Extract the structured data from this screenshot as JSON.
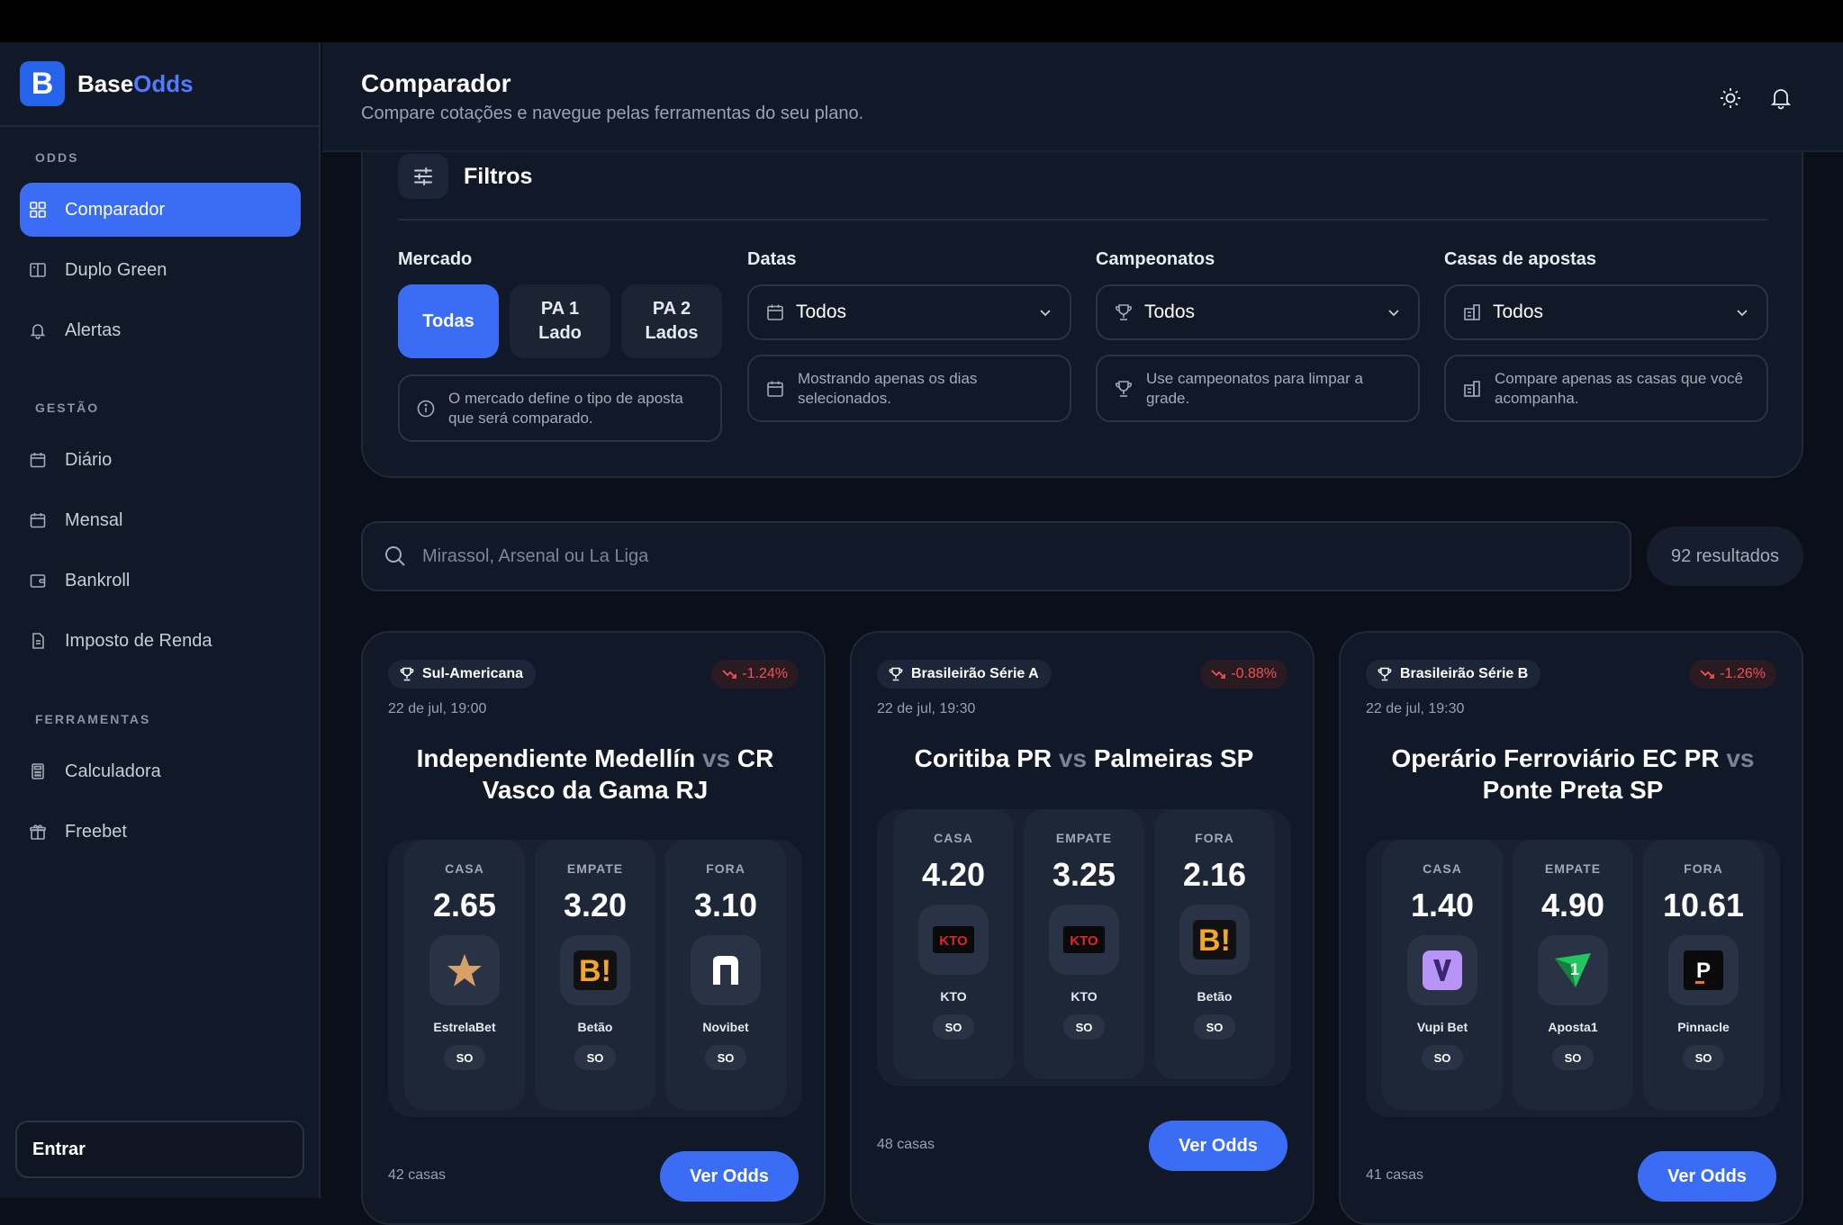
{
  "brand": {
    "name_base": "Base",
    "name_accent": "Odds",
    "logo_letter": "B"
  },
  "sidebar": {
    "sections": [
      {
        "label": "ODDS",
        "items": [
          {
            "label": "Comparador",
            "icon": "grid-icon",
            "active": true
          },
          {
            "label": "Duplo Green",
            "icon": "columns-icon"
          },
          {
            "label": "Alertas",
            "icon": "bell-icon"
          }
        ]
      },
      {
        "label": "GESTÃO",
        "items": [
          {
            "label": "Diário",
            "icon": "calendar-icon"
          },
          {
            "label": "Mensal",
            "icon": "calendar-icon"
          },
          {
            "label": "Bankroll",
            "icon": "wallet-icon"
          },
          {
            "label": "Imposto de Renda",
            "icon": "document-icon"
          }
        ]
      },
      {
        "label": "FERRAMENTAS",
        "items": [
          {
            "label": "Calculadora",
            "icon": "calculator-icon"
          },
          {
            "label": "Freebet",
            "icon": "gift-icon"
          }
        ]
      }
    ],
    "login_label": "Entrar"
  },
  "header": {
    "title": "Comparador",
    "subtitle": "Compare cotações e navegue pelas ferramentas do seu plano."
  },
  "filters": {
    "title": "Filtros",
    "mercado": {
      "label": "Mercado",
      "options": [
        "Todas",
        "PA 1 Lado",
        "PA 2 Lados"
      ],
      "selected": "Todas",
      "hint": "O mercado define o tipo de aposta que será comparado."
    },
    "datas": {
      "label": "Datas",
      "value": "Todos",
      "hint": "Mostrando apenas os dias selecionados."
    },
    "campeonatos": {
      "label": "Campeonatos",
      "value": "Todos",
      "hint": "Use campeonatos para limpar a grade."
    },
    "casas": {
      "label": "Casas de apostas",
      "value": "Todos",
      "hint": "Compare apenas as casas que você acompanha."
    }
  },
  "search": {
    "placeholder": "Mirassol, Arsenal ou La Liga",
    "results": "92 resultados"
  },
  "cards": [
    {
      "league": "Sul-Americana",
      "delta": "-1.24%",
      "date": "22 de jul, 19:00",
      "home": "Independiente Medellín",
      "vs": "vs",
      "away": "CR Vasco da Gama RJ",
      "odds": [
        {
          "label": "CASA",
          "value": "2.65",
          "house": "EstrelaBet",
          "tag": "SO"
        },
        {
          "label": "EMPATE",
          "value": "3.20",
          "house": "Betão",
          "tag": "SO"
        },
        {
          "label": "FORA",
          "value": "3.10",
          "house": "Novibet",
          "tag": "SO"
        }
      ],
      "count": "42 casas",
      "button": "Ver Odds"
    },
    {
      "league": "Brasileirão Série A",
      "delta": "-0.88%",
      "date": "22 de jul, 19:30",
      "home": "Coritiba PR",
      "vs": "vs",
      "away": "Palmeiras SP",
      "odds": [
        {
          "label": "CASA",
          "value": "4.20",
          "house": "KTO",
          "tag": "SO"
        },
        {
          "label": "EMPATE",
          "value": "3.25",
          "house": "KTO",
          "tag": "SO"
        },
        {
          "label": "FORA",
          "value": "2.16",
          "house": "Betão",
          "tag": "SO"
        }
      ],
      "count": "48 casas",
      "button": "Ver Odds"
    },
    {
      "league": "Brasileirão Série B",
      "delta": "-1.26%",
      "date": "22 de jul, 19:30",
      "home": "Operário Ferroviário EC PR",
      "vs": "vs",
      "away": "Ponte Preta SP",
      "odds": [
        {
          "label": "CASA",
          "value": "1.40",
          "house": "Vupi Bet",
          "tag": "SO"
        },
        {
          "label": "EMPATE",
          "value": "4.90",
          "house": "Aposta1",
          "tag": "SO"
        },
        {
          "label": "FORA",
          "value": "10.61",
          "house": "Pinnacle",
          "tag": "SO"
        }
      ],
      "count": "41 casas",
      "button": "Ver Odds"
    }
  ],
  "colors": {
    "accent": "#3b6cf6",
    "negative": "#f05252",
    "background": "#0b0f1a",
    "panel": "#111827"
  }
}
